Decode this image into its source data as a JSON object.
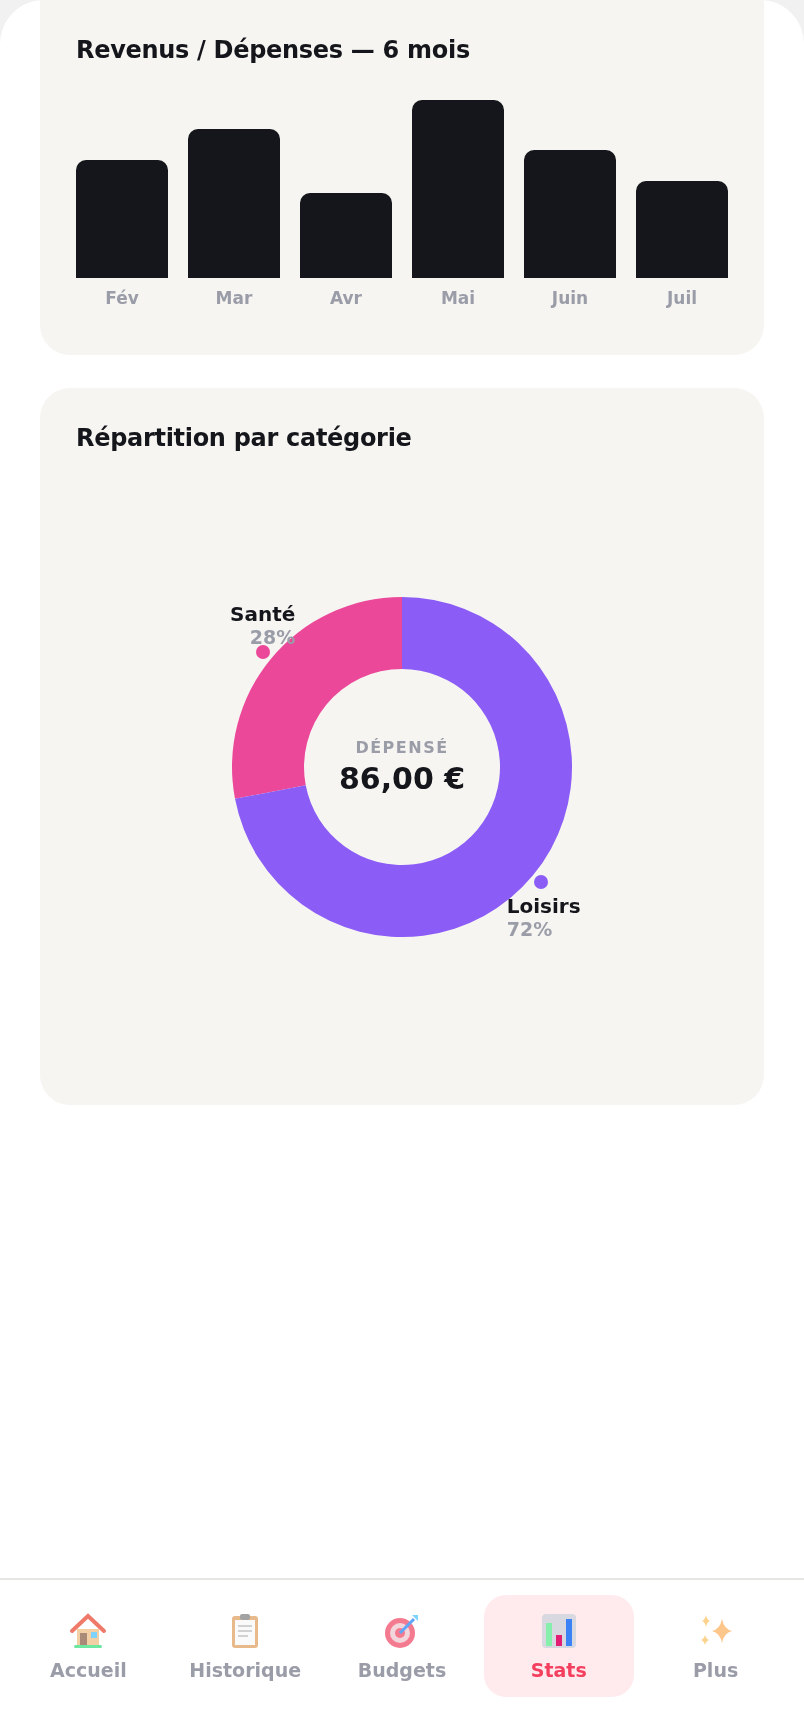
{
  "income_chart": {
    "title": "Revenus / Dépenses — 6 mois",
    "months": [
      "Fév",
      "Mar",
      "Avr",
      "Mai",
      "Juin",
      "Juil"
    ]
  },
  "category_chart": {
    "title": "Répartition par catégorie",
    "center_label": "DÉPENSÉ",
    "center_value": "86,00 €",
    "chart_data": {
      "type": "donut",
      "categories": [
        "Santé",
        "Loisirs"
      ],
      "values": [
        28,
        72
      ],
      "value_labels": [
        "28%",
        "72%"
      ]
    },
    "slices": [
      {
        "color": "#ec4899"
      },
      {
        "color": "#8b5cf6"
      }
    ]
  },
  "nav": [
    {
      "label": "Accueil",
      "selected": false
    },
    {
      "label": "Historique",
      "selected": false
    },
    {
      "label": "Budgets",
      "selected": false
    },
    {
      "label": "Stats",
      "selected": true
    },
    {
      "label": "Plus",
      "selected": false
    }
  ]
}
